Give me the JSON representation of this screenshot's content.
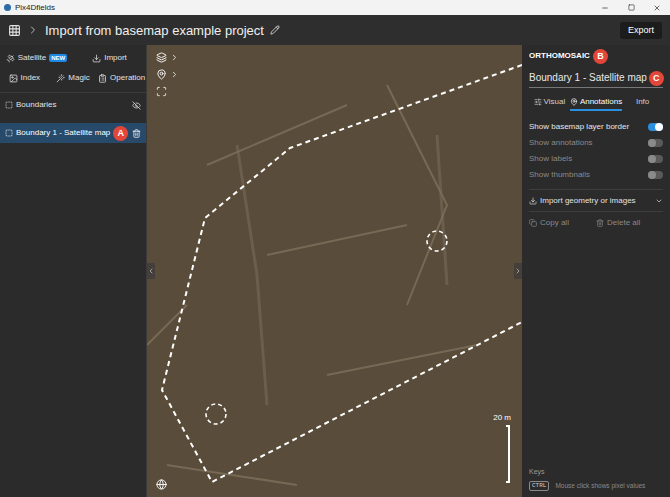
{
  "window": {
    "title": "Pix4Dfields"
  },
  "header": {
    "project_title": "Import from basemap example project",
    "export_button": "Export"
  },
  "toolbar": {
    "rows": [
      [
        {
          "label": "Satellite",
          "badge": "NEW"
        },
        {
          "label": "Import",
          "badge": ""
        }
      ],
      [
        {
          "label": "Index",
          "badge": ""
        },
        {
          "label": "Magic",
          "badge": ""
        },
        {
          "label": "Operation",
          "badge": ""
        }
      ]
    ]
  },
  "layers": {
    "section": "Boundaries",
    "items": [
      {
        "label": "Boundary 1 - Satellite map",
        "selected": true,
        "marker": "A"
      }
    ]
  },
  "map": {
    "scale": "20 m"
  },
  "panel": {
    "section": "ORTHOMOSAIC",
    "section_marker": "B",
    "name": "Boundary 1 - Satellite map",
    "name_marker": "C",
    "tabs": [
      {
        "label": "Visual",
        "selected": false
      },
      {
        "label": "Annotations",
        "selected": true
      },
      {
        "label": "Info",
        "selected": false
      }
    ],
    "toggles": [
      {
        "label": "Show basemap layer border",
        "on": true,
        "disabled": false
      },
      {
        "label": "Show annotations",
        "on": false,
        "disabled": true
      },
      {
        "label": "Show labels",
        "on": false,
        "disabled": true
      },
      {
        "label": "Show thumbnails",
        "on": false,
        "disabled": true
      }
    ],
    "import": "Import geometry or images",
    "actions": [
      {
        "label": "Copy all",
        "disabled": true
      },
      {
        "label": "Delete all",
        "disabled": true
      }
    ],
    "keys": {
      "title": "Keys",
      "key": "CTRL",
      "description": "Mouse click shows pixel values"
    }
  }
}
